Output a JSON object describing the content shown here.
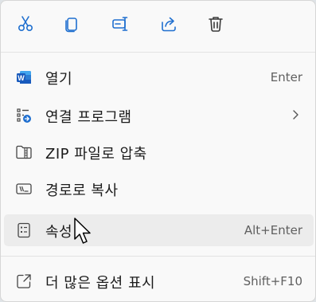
{
  "toolbar": {
    "buttons": [
      {
        "name": "cut",
        "icon": "scissors-icon"
      },
      {
        "name": "copy",
        "icon": "copy-icon"
      },
      {
        "name": "rename",
        "icon": "rename-icon"
      },
      {
        "name": "share",
        "icon": "share-icon"
      },
      {
        "name": "delete",
        "icon": "trash-icon"
      }
    ]
  },
  "menu": {
    "items": [
      {
        "label": "열기",
        "icon": "word-icon",
        "accelerator": "Enter"
      },
      {
        "label": "연결 프로그램",
        "icon": "open-with-icon",
        "has_submenu": true
      },
      {
        "label": "ZIP 파일로 압축",
        "icon": "zip-folder-icon"
      },
      {
        "label": "경로로 복사",
        "icon": "copy-path-icon"
      },
      {
        "label": "속성",
        "icon": "properties-icon",
        "accelerator": "Alt+Enter",
        "hovered": true
      },
      {
        "label": "더 많은 옵션 표시",
        "icon": "more-options-icon",
        "accelerator": "Shift+F10"
      }
    ]
  },
  "colors": {
    "accent": "#1f6fcf",
    "word_blue": "#185abd",
    "menu_bg": "#f9f9f9",
    "hover_bg": "#ececec"
  }
}
